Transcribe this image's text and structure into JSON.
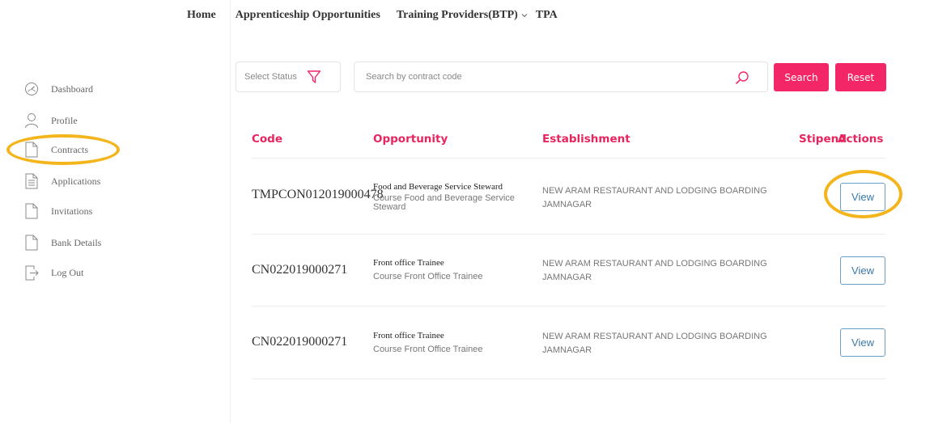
{
  "topnav": {
    "home": "Home",
    "apprenticeship": "Apprenticeship Opportunities",
    "training_providers": "Training Providers(BTP)",
    "tpa": "TPA"
  },
  "sidebar": {
    "items": [
      {
        "label": "Dashboard",
        "icon": "dashboard-icon"
      },
      {
        "label": "Profile",
        "icon": "user-icon"
      },
      {
        "label": "Contracts",
        "icon": "document-icon"
      },
      {
        "label": "Applications",
        "icon": "document-lines-icon"
      },
      {
        "label": "Invitations",
        "icon": "document-icon"
      },
      {
        "label": "Bank Details",
        "icon": "document-icon"
      },
      {
        "label": "Log Out",
        "icon": "logout-icon"
      }
    ],
    "highlighted": "Contracts"
  },
  "filters": {
    "status_placeholder": "Select Status",
    "search_placeholder": "Search by contract code",
    "search_button": "Search",
    "reset_button": "Reset"
  },
  "table": {
    "headers": {
      "code": "Code",
      "opportunity": "Opportunity",
      "establishment": "Establishment",
      "stipend": "Stipend",
      "actions": "Actions"
    },
    "rows": [
      {
        "code": "TMPCON012019000478",
        "opportunity": "Food and Beverage Service Steward",
        "course": "Course Food and Beverage Service Steward",
        "establishment_line1": "NEW ARAM RESTAURANT AND LODGING BOARDING",
        "establishment_line2": "JAMNAGAR",
        "action": "View"
      },
      {
        "code": "CN022019000271",
        "opportunity": "Front office Trainee",
        "course": "Course Front Office Trainee",
        "establishment_line1": "NEW ARAM RESTAURANT AND LODGING BOARDING",
        "establishment_line2": "JAMNAGAR",
        "action": "View"
      },
      {
        "code": "CN022019000271",
        "opportunity": "Front office Trainee",
        "course": "Course Front Office Trainee",
        "establishment_line1": "NEW ARAM RESTAURANT AND LODGING BOARDING",
        "establishment_line2": "JAMNAGAR",
        "action": "View"
      }
    ]
  },
  "colors": {
    "accent": "#f32667",
    "header_text": "#e8245f",
    "highlight_ring": "#f3b51b",
    "view_border": "#6a9ec7"
  }
}
